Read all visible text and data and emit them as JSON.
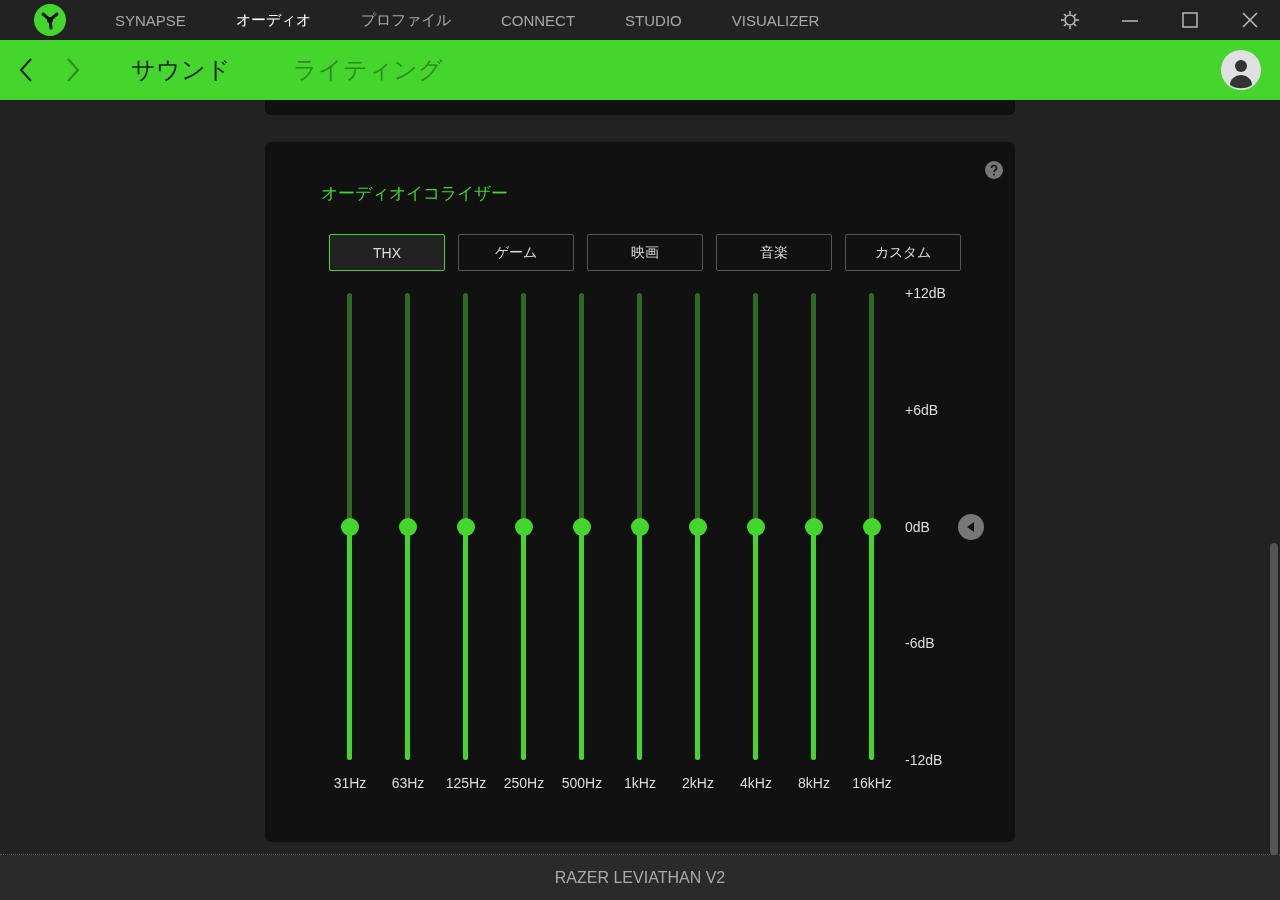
{
  "nav_tabs": [
    {
      "label": "SYNAPSE",
      "selected": false
    },
    {
      "label": "オーディオ",
      "selected": true
    },
    {
      "label": "プロファイル",
      "selected": false
    },
    {
      "label": "CONNECT",
      "selected": false
    },
    {
      "label": "STUDIO",
      "selected": false
    },
    {
      "label": "VISUALIZER",
      "selected": false
    }
  ],
  "back": {
    "disabled": false
  },
  "forward": {
    "disabled": true
  },
  "sub_tabs": [
    {
      "label": "サウンド",
      "selected": true
    },
    {
      "label": "ライティング",
      "selected": false
    }
  ],
  "equalizer": {
    "title": "オーディオイコライザー",
    "presets": [
      {
        "label": "THX",
        "selected": true
      },
      {
        "label": "ゲーム",
        "selected": false
      },
      {
        "label": "映画",
        "selected": false
      },
      {
        "label": "音楽",
        "selected": false
      },
      {
        "label": "カスタム",
        "selected": false
      }
    ],
    "bands": [
      {
        "label": "31Hz",
        "level": 0.5
      },
      {
        "label": "63Hz",
        "level": 0.5
      },
      {
        "label": "125Hz",
        "level": 0.5
      },
      {
        "label": "250Hz",
        "level": 0.5
      },
      {
        "label": "500Hz",
        "level": 0.5
      },
      {
        "label": "1kHz",
        "level": 0.5
      },
      {
        "label": "2kHz",
        "level": 0.5
      },
      {
        "label": "4kHz",
        "level": 0.5
      },
      {
        "label": "8kHz",
        "level": 0.5
      },
      {
        "label": "16kHz",
        "level": 0.5
      }
    ],
    "scale": [
      "+12dB",
      "+6dB",
      "0dB",
      "-6dB",
      "-12dB"
    ]
  },
  "footer": {
    "device": "RAZER LEVIATHAN V2"
  }
}
